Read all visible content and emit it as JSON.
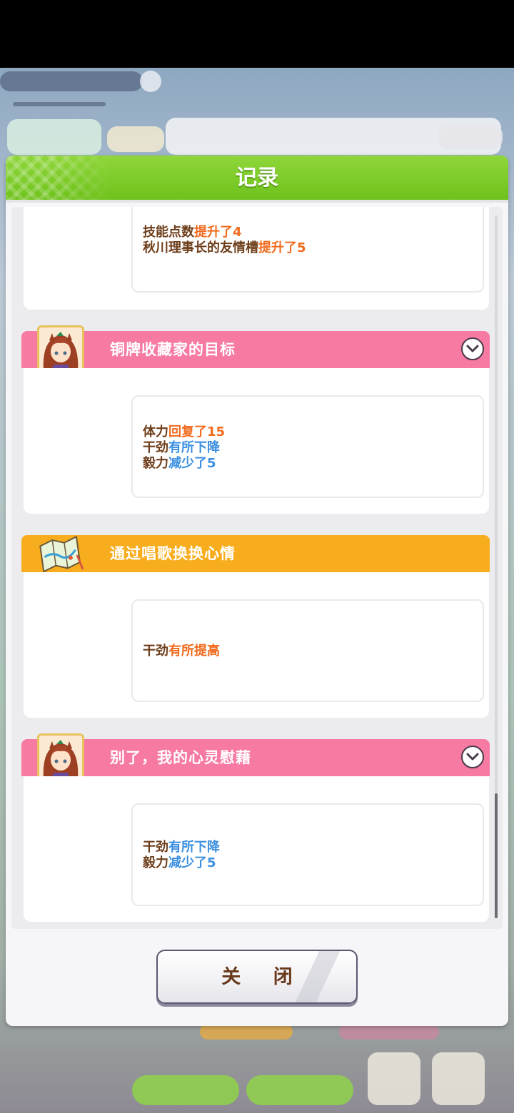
{
  "dialog": {
    "title": "记录",
    "close_label": "关 闭"
  },
  "top_card": {
    "lines": [
      {
        "stat": "技能点数",
        "change": "提升了4",
        "tone": "up"
      },
      {
        "stat": "秋川理事长的友情槽",
        "change": "提升了5",
        "tone": "up"
      }
    ]
  },
  "entries": [
    {
      "title": "铜牌收藏家的目标",
      "bar_color": "#f77aa3",
      "icon": "character-portrait-icon",
      "expandable": true,
      "lines": [
        {
          "stat": "体力",
          "change": "回复了15",
          "tone": "up"
        },
        {
          "stat": "干劲",
          "change": "有所下降",
          "tone": "down"
        },
        {
          "stat": "毅力",
          "change": "减少了5",
          "tone": "down"
        }
      ]
    },
    {
      "title": "通过唱歌换换心情",
      "bar_color": "#f8ad1e",
      "icon": "map-icon",
      "expandable": false,
      "lines": [
        {
          "stat": "干劲",
          "change": "有所提高",
          "tone": "up"
        }
      ]
    },
    {
      "title": "别了，我的心灵慰藉",
      "bar_color": "#f77aa3",
      "icon": "character-portrait-icon",
      "expandable": true,
      "lines": [
        {
          "stat": "干劲",
          "change": "有所下降",
          "tone": "down"
        },
        {
          "stat": "毅力",
          "change": "减少了5",
          "tone": "down"
        }
      ]
    }
  ],
  "colors": {
    "header_green": "#7acb27",
    "increase_orange": "#f06a1c",
    "decrease_blue": "#3c8fe0",
    "stat_brown": "#6e3e1b"
  }
}
